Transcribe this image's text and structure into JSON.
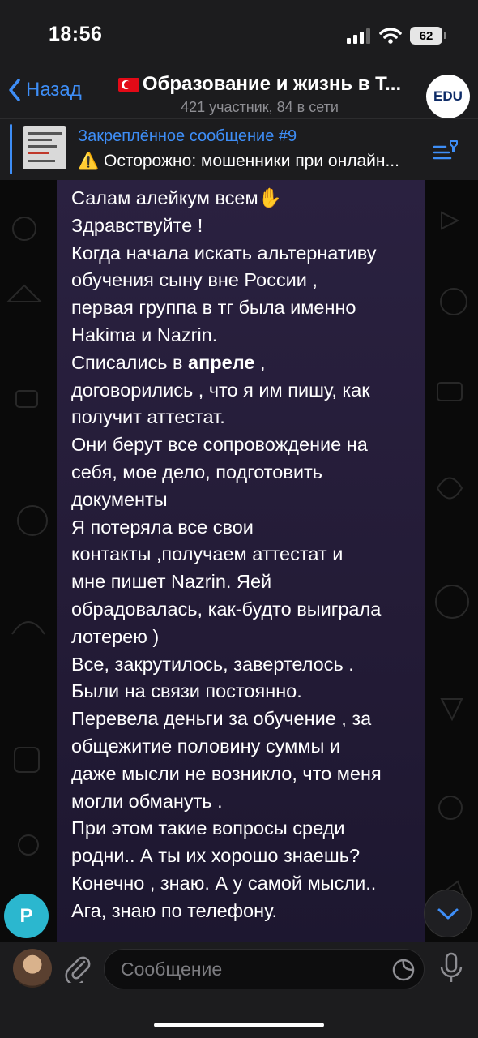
{
  "status_bar": {
    "time": "18:56",
    "battery": "62"
  },
  "header": {
    "back_label": "Назад",
    "title": "Образование и жизнь в Т...",
    "subtitle": "421 участник, 84 в сети",
    "avatar_text": "EDU"
  },
  "pinned": {
    "label": "Закреплённое сообщение #9",
    "text": "⚠️ Осторожно: мошенники при онлайн..."
  },
  "message": {
    "lines": [
      "Салам алейкум всем✋",
      "Здравствуйте !",
      "Когда начала искать альтернативу",
      "обучения сыну вне России ,",
      "первая группа в тг была именно",
      "Hakima и Nazrin.",
      "Списались в ",
      "договорились , что я им пишу, как",
      "получит аттестат.",
      "Они берут все сопровождение на",
      "себя, мое дело, подготовить",
      "документы",
      "Я потеряла все свои",
      "контакты ,получаем аттестат и",
      "мне пишет Nazrin. Яей",
      "обрадовалась, как-будто выиграла",
      "лотерею )",
      "Все, закрутилось, завертелось .",
      "Были на связи постоянно.",
      "Перевела деньги за обучение , за",
      "общежитие половину суммы и",
      "даже мысли не возникло, что меня",
      "могли обмануть .",
      "При этом такие вопросы среди",
      "родни.. А ты их хорошо знаешь?",
      "Конечно , знаю. А у самой мысли..",
      "Ага, знаю по телефону."
    ],
    "bold_word": "апреле",
    "after_bold": " ,"
  },
  "sender_avatar_letter": "P",
  "input": {
    "placeholder": "Сообщение"
  },
  "colors": {
    "accent": "#3e8ef7",
    "bubble": "#2a2140",
    "sender_avatar": "#2bb7cf"
  }
}
